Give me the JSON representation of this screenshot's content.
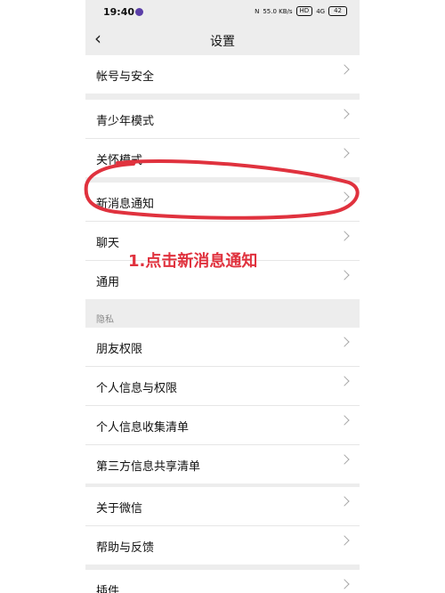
{
  "status_bar": {
    "time": "19:40",
    "network": "55.0 KB/s",
    "hd": "HD",
    "signal": "4G",
    "battery": "42"
  },
  "header": {
    "title": "设置",
    "back_icon": "chevron-left-icon"
  },
  "groups": [
    {
      "items": [
        {
          "label": "帐号与安全"
        }
      ]
    },
    {
      "items": [
        {
          "label": "青少年模式"
        },
        {
          "label": "关怀模式"
        }
      ]
    },
    {
      "items": [
        {
          "label": "新消息通知"
        },
        {
          "label": "聊天"
        },
        {
          "label": "通用"
        }
      ]
    },
    {
      "section": "隐私",
      "items": [
        {
          "label": "朋友权限"
        },
        {
          "label": "个人信息与权限"
        },
        {
          "label": "个人信息收集清单"
        },
        {
          "label": "第三方信息共享清单"
        }
      ]
    },
    {
      "items": [
        {
          "label": "关于微信"
        },
        {
          "label": "帮助与反馈"
        }
      ]
    },
    {
      "items": [
        {
          "label": "插件"
        }
      ]
    }
  ],
  "annotation": {
    "text": "1.点击新消息通知",
    "color": "#e0323e"
  }
}
